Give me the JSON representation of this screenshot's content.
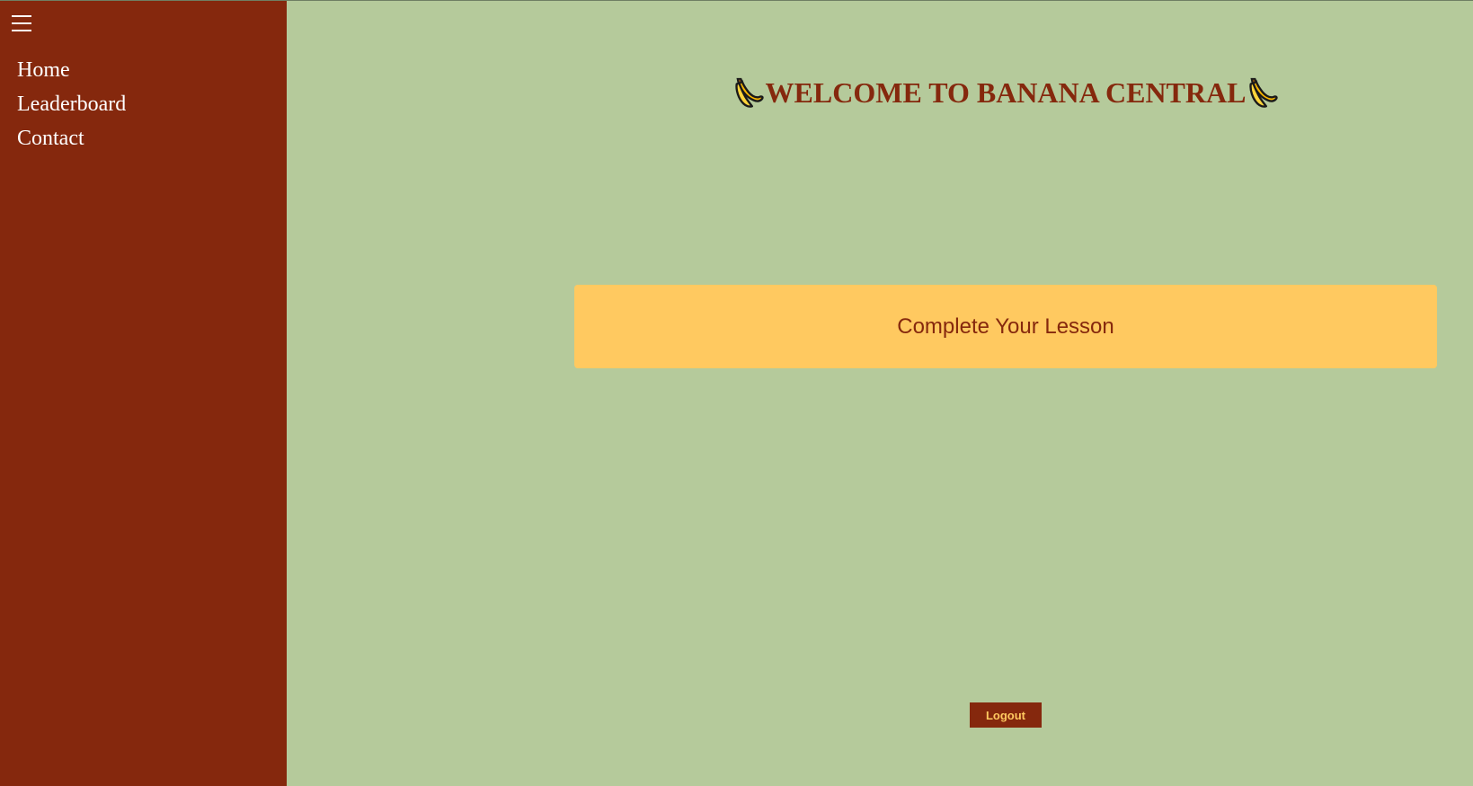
{
  "sidebar": {
    "menu_icon": "hamburger-menu-icon",
    "items": [
      {
        "label": "Home"
      },
      {
        "label": "Leaderboard"
      },
      {
        "label": "Contact"
      }
    ]
  },
  "header": {
    "title": "WELCOME TO BANANA CENTRAL",
    "decoration_icon": "banana-icon"
  },
  "main": {
    "lesson_card_label": "Complete Your Lesson"
  },
  "footer": {
    "logout_label": "Logout"
  },
  "colors": {
    "sidebar_bg": "#85280d",
    "page_bg": "#b5ca9b",
    "accent": "#ffc960",
    "text_dark": "#85280d",
    "text_light": "#ffffff"
  }
}
